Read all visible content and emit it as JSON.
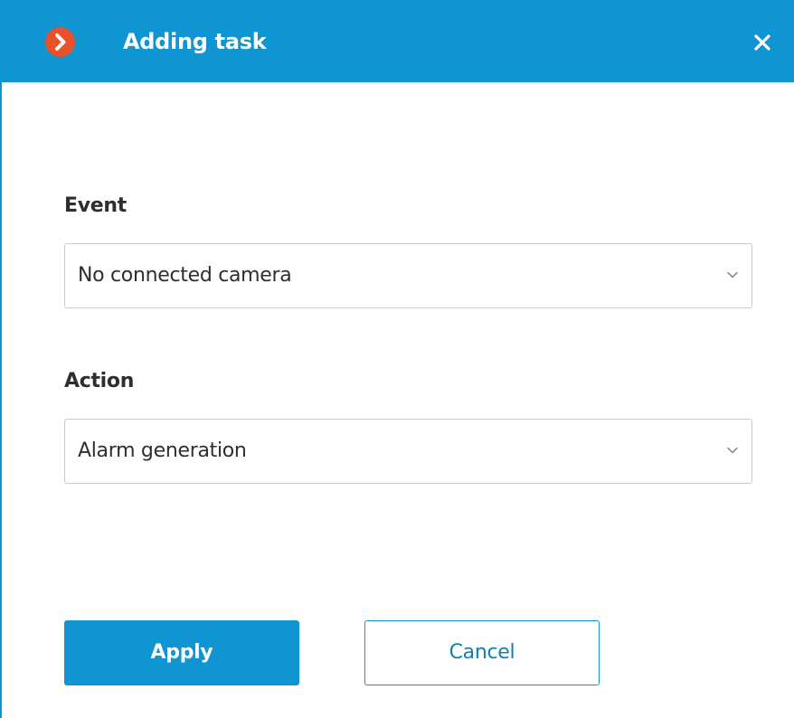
{
  "dialog": {
    "title": "Adding task",
    "app_icon": "chevron-right-circle-icon",
    "close_icon": "close-icon",
    "accent_color": "#0f95d1",
    "icon_color": "#e8512a"
  },
  "form": {
    "event_label": "Event",
    "event_value": "No connected camera",
    "action_label": "Action",
    "action_value": "Alarm generation",
    "dropdown_icon": "chevron-down-icon"
  },
  "buttons": {
    "apply_label": "Apply",
    "cancel_label": "Cancel"
  }
}
